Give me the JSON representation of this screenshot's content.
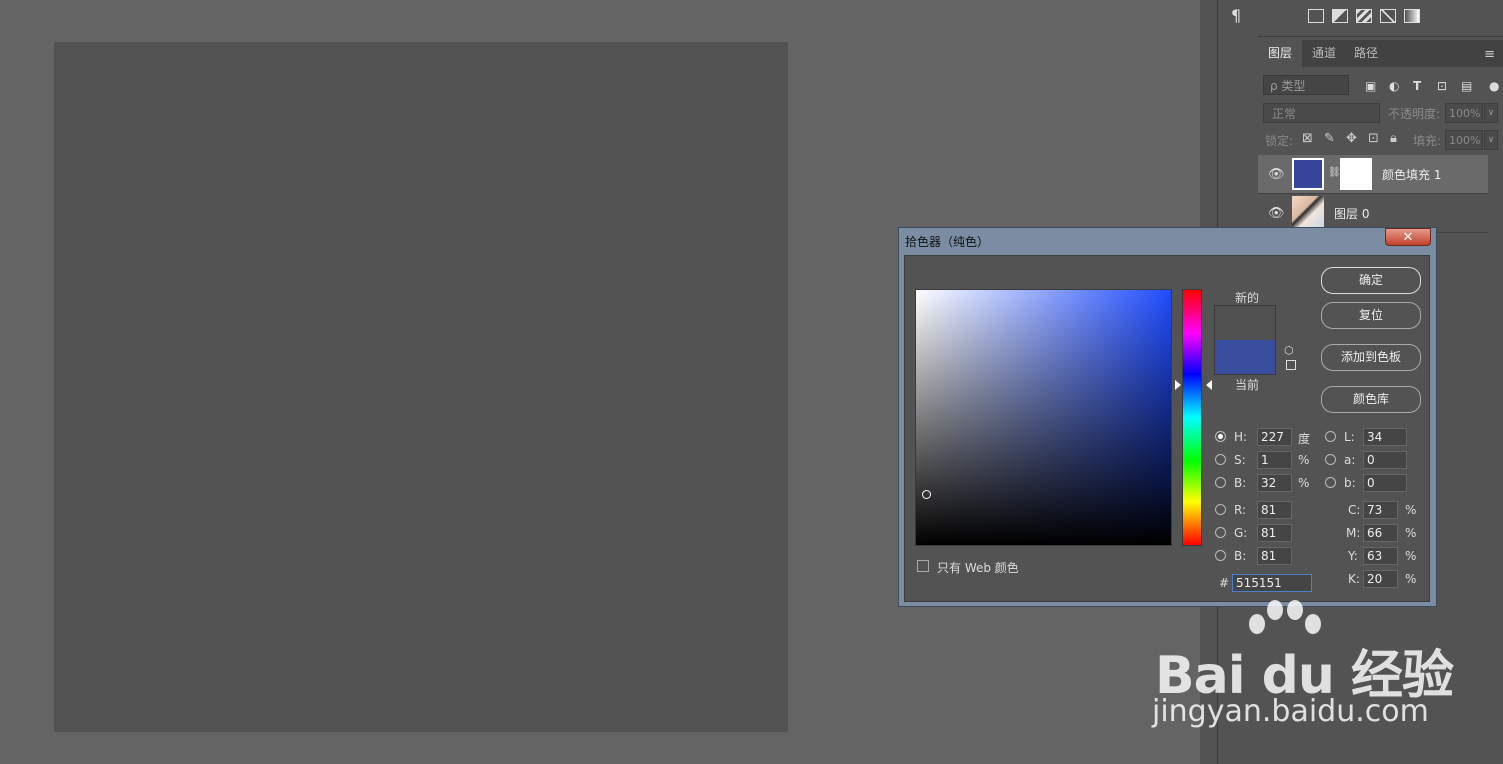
{
  "panels": {
    "paragraph_icon": "¶",
    "tabs": [
      "图层",
      "通道",
      "路径"
    ],
    "panel_menu": "≡",
    "filter_placeholder": "ρ 类型",
    "blend_mode": "正常",
    "opacity_label": "不透明度:",
    "opacity_value": "100%",
    "lock_label": "锁定:",
    "fill_label": "填充:",
    "fill_value": "100%",
    "layers": [
      {
        "name": "颜色填充 1",
        "thumb_color": "#37469a"
      },
      {
        "name": "图层 0"
      }
    ]
  },
  "color_picker": {
    "title": "拾色器（纯色）",
    "close": "✕",
    "new_label": "新的",
    "current_label": "当前",
    "new_color": "#515151",
    "current_color": "#3a4ea0",
    "buttons": {
      "ok": "确定",
      "reset": "复位",
      "add_swatch": "添加到色板",
      "libraries": "颜色库"
    },
    "fields": {
      "H": {
        "label": "H:",
        "value": "227",
        "unit": "度"
      },
      "S": {
        "label": "S:",
        "value": "1",
        "unit": "%"
      },
      "Bv": {
        "label": "B:",
        "value": "32",
        "unit": "%"
      },
      "R": {
        "label": "R:",
        "value": "81"
      },
      "G": {
        "label": "G:",
        "value": "81"
      },
      "Bc": {
        "label": "B:",
        "value": "81"
      },
      "L": {
        "label": "L:",
        "value": "34"
      },
      "a": {
        "label": "a:",
        "value": "0"
      },
      "b": {
        "label": "b:",
        "value": "0"
      },
      "C": {
        "label": "C:",
        "value": "73",
        "unit": "%"
      },
      "M": {
        "label": "M:",
        "value": "66",
        "unit": "%"
      },
      "Y": {
        "label": "Y:",
        "value": "63",
        "unit": "%"
      },
      "K": {
        "label": "K:",
        "value": "20",
        "unit": "%"
      }
    },
    "hex_label": "#",
    "hex_value": "515151",
    "web_only_label": "只有 Web 颜色"
  },
  "watermark": {
    "logo": "Bai du 经验",
    "url": "jingyan.baidu.com"
  }
}
